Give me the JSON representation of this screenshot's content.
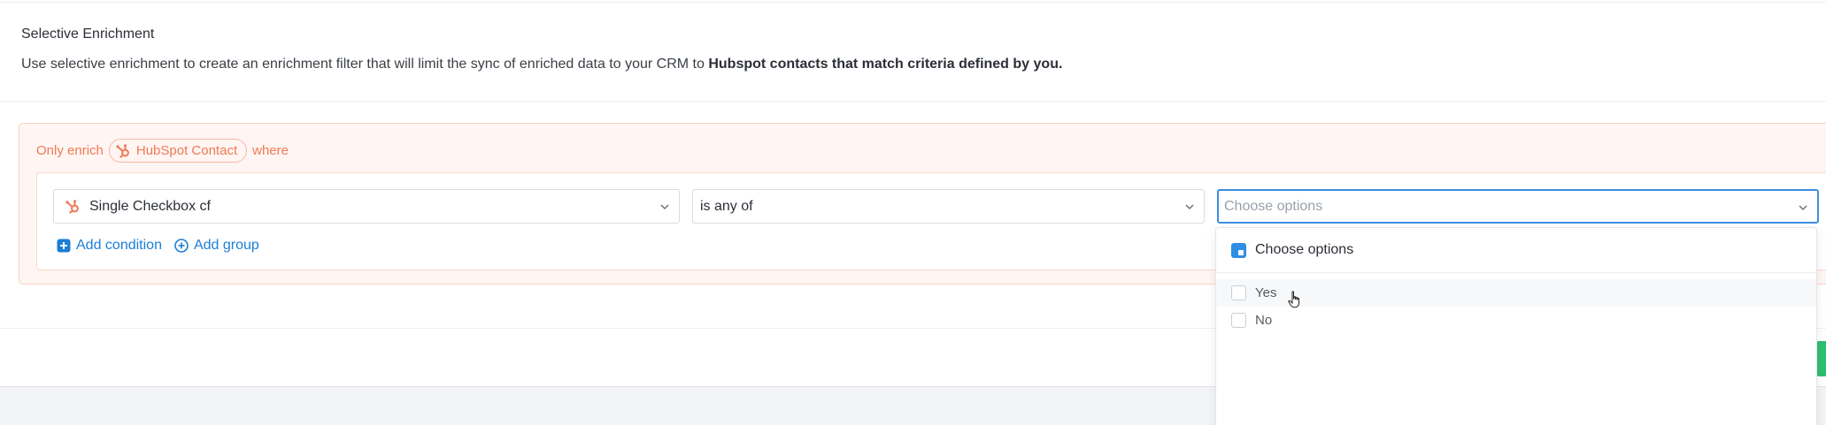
{
  "section": {
    "title": "Selective Enrichment",
    "desc_prefix": "Use selective enrichment to create an enrichment filter that will limit the sync of enriched data to your CRM to",
    "desc_bold": "Hubspot contacts that match criteria defined by you."
  },
  "filter": {
    "only_enrich": "Only enrich",
    "object_chip": "HubSpot Contact",
    "where": "where",
    "condition": {
      "field": "Single Checkbox cf",
      "operator": "is any of",
      "value_placeholder": "Choose options"
    },
    "add_condition": "Add condition",
    "add_group": "Add group"
  },
  "dropdown": {
    "header": "Choose options",
    "options": [
      {
        "label": "Yes",
        "checked": false
      },
      {
        "label": "No",
        "checked": false
      }
    ]
  },
  "colors": {
    "accent": "#f07a55",
    "link": "#1c7ed6",
    "focus": "#3d8fe0",
    "save": "#2fbf71"
  },
  "icons": {
    "hubspot": "hubspot-icon",
    "chevron": "chevron-down-icon",
    "add_condition": "plus-square-icon",
    "add_group": "plus-circle-icon",
    "select_all": "select-all-icon",
    "cursor": "hand-cursor-icon"
  }
}
